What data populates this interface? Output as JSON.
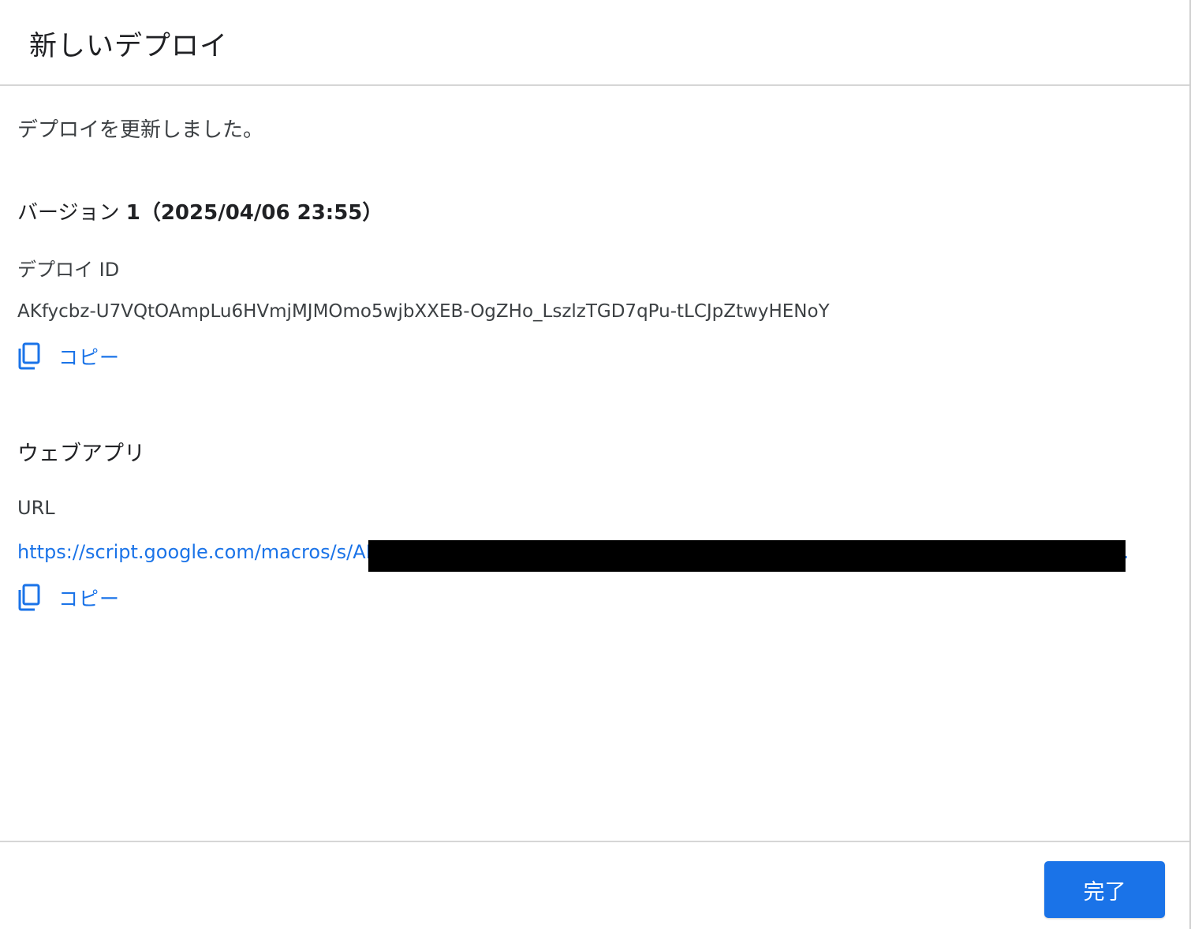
{
  "dialog": {
    "title": "新しいデプロイ",
    "status": "デプロイを更新しました。",
    "version": {
      "label": "バージョン",
      "number": "1",
      "timestamp": "（2025/04/06 23:55）"
    },
    "deployment": {
      "id_label": "デプロイ ID",
      "id_value": "AKfycbz-U7VQtOAmpLu6HVmjMJMOmo5wjbXXEB-OgZHo_LszlzTGD7qPu-tLCJpZtwyHENoY",
      "copy_label": "コピー"
    },
    "webapp": {
      "section_title": "ウェブアプリ",
      "url_label": "URL",
      "url_value": "https://script.google.com/macros/s/AKfycbz-U7VQtOAmpLu6HVmjMJMOmo5wjbXXEB-OgZHo_LszlzTGD7qPu-tLCJpZt…",
      "copy_label": "コピー"
    },
    "footer": {
      "done_label": "完了"
    }
  },
  "colors": {
    "accent": "#1a73e8",
    "text": "#3c4043",
    "divider": "#d6d6d6",
    "redaction": "#000000"
  },
  "icons": {
    "copy": "copy-icon"
  }
}
